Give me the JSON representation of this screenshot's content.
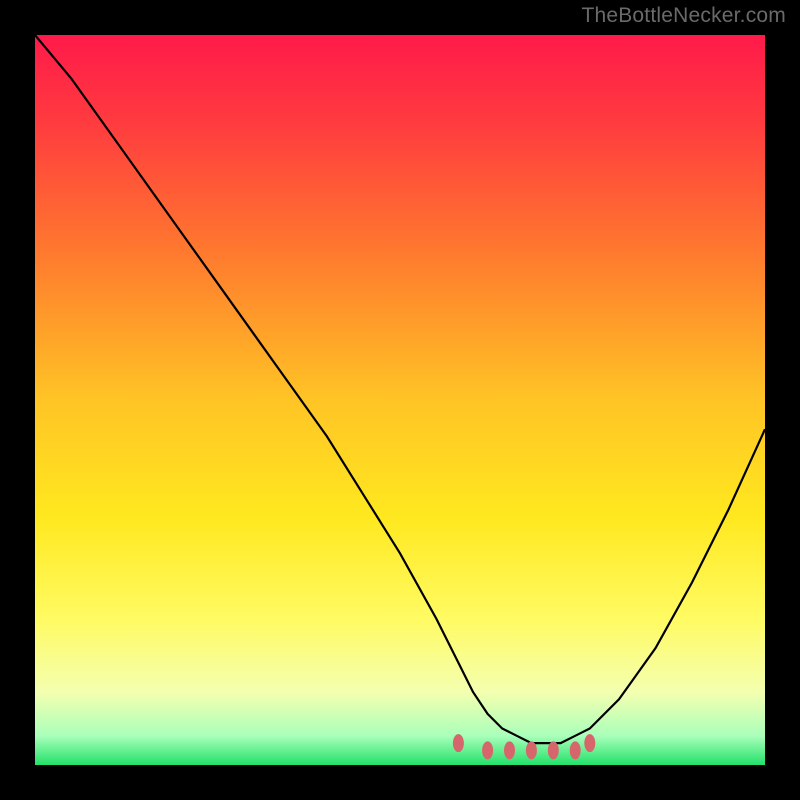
{
  "watermark": "TheBottleNecker.com",
  "chart_data": {
    "type": "line",
    "title": "",
    "xlabel": "",
    "ylabel": "",
    "xlim": [
      0,
      100
    ],
    "ylim": [
      0,
      100
    ],
    "grid": false,
    "background": "rainbow_gradient_red_to_green_vertical",
    "series": [
      {
        "name": "bottleneck-curve",
        "x": [
          0,
          5,
          10,
          15,
          20,
          25,
          30,
          35,
          40,
          45,
          50,
          55,
          58,
          60,
          62,
          64,
          66,
          68,
          70,
          72,
          74,
          76,
          80,
          85,
          90,
          95,
          100
        ],
        "y": [
          100,
          94,
          87,
          80,
          73,
          66,
          59,
          52,
          45,
          37,
          29,
          20,
          14,
          10,
          7,
          5,
          4,
          3,
          3,
          3,
          4,
          5,
          9,
          16,
          25,
          35,
          46
        ]
      }
    ],
    "annotations": [
      {
        "name": "marker-dots-along-valley",
        "shape": "dots",
        "color": "#d7666c",
        "points": [
          [
            58,
            3
          ],
          [
            62,
            2
          ],
          [
            65,
            2
          ],
          [
            68,
            2
          ],
          [
            71,
            2
          ],
          [
            74,
            2
          ],
          [
            76,
            3
          ]
        ]
      }
    ],
    "colors": {
      "gradient_stops": [
        {
          "offset": 0.0,
          "color": "#ff1a4a"
        },
        {
          "offset": 0.12,
          "color": "#ff3b3f"
        },
        {
          "offset": 0.3,
          "color": "#ff7a2e"
        },
        {
          "offset": 0.5,
          "color": "#ffc425"
        },
        {
          "offset": 0.66,
          "color": "#ffe81f"
        },
        {
          "offset": 0.8,
          "color": "#fffb63"
        },
        {
          "offset": 0.9,
          "color": "#f4ffb0"
        },
        {
          "offset": 0.96,
          "color": "#aaffba"
        },
        {
          "offset": 1.0,
          "color": "#22e26a"
        }
      ],
      "curve": "#000000",
      "dot_fill": "#d7666c"
    }
  }
}
